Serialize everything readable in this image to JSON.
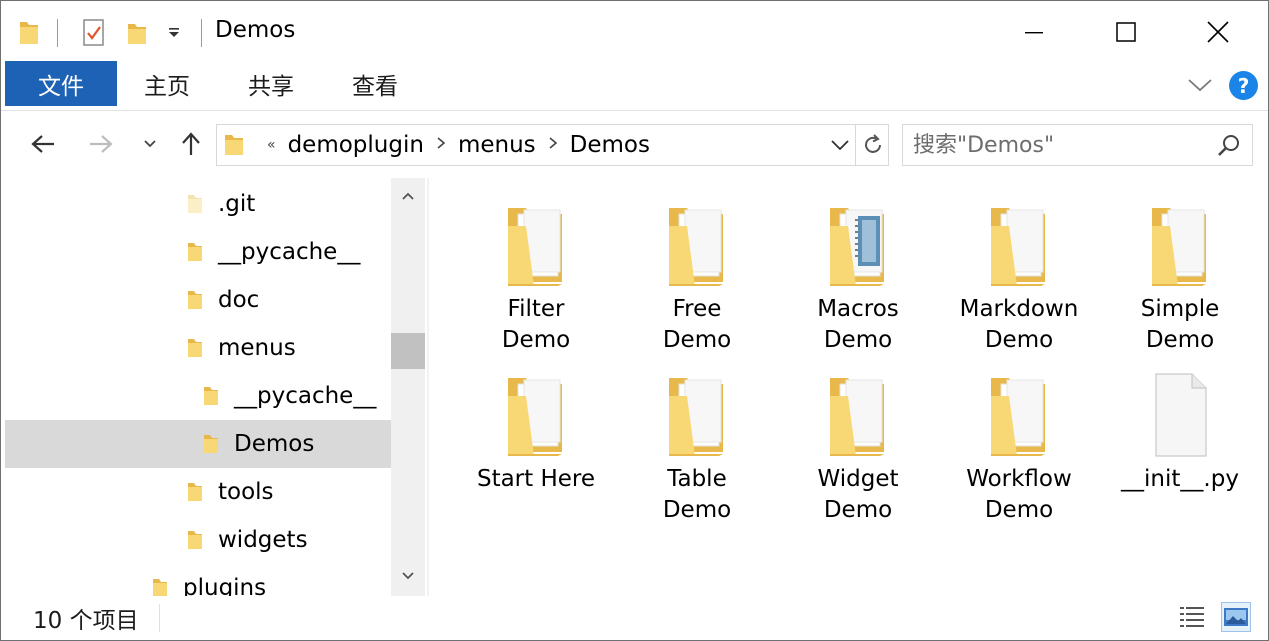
{
  "window": {
    "title": "Demos"
  },
  "ribbon": {
    "tabs": [
      {
        "label": "文件"
      },
      {
        "label": "主页"
      },
      {
        "label": "共享"
      },
      {
        "label": "查看"
      }
    ],
    "help_label": "?"
  },
  "address": {
    "overflow_glyph": "«",
    "segments": [
      "demoplugin",
      "menus",
      "Demos"
    ]
  },
  "search": {
    "placeholder": "搜索\"Demos\""
  },
  "tree": {
    "items": [
      {
        "label": ".git",
        "level": 1
      },
      {
        "label": "__pycache__",
        "level": 1
      },
      {
        "label": "doc",
        "level": 1
      },
      {
        "label": "menus",
        "level": 1
      },
      {
        "label": "__pycache__",
        "level": 2
      },
      {
        "label": "Demos",
        "level": 2,
        "selected": true
      },
      {
        "label": "tools",
        "level": 1
      },
      {
        "label": "widgets",
        "level": 1
      },
      {
        "label": "plugins",
        "level": 0
      }
    ]
  },
  "content": {
    "items": [
      {
        "name_line1": "Filter",
        "name_line2": "Demo",
        "kind": "folder"
      },
      {
        "name_line1": "Free",
        "name_line2": "Demo",
        "kind": "folder"
      },
      {
        "name_line1": "Macros",
        "name_line2": "Demo",
        "kind": "folder-notebook"
      },
      {
        "name_line1": "Markdown",
        "name_line2": "Demo",
        "kind": "folder"
      },
      {
        "name_line1": "Simple",
        "name_line2": "Demo",
        "kind": "folder"
      },
      {
        "name_line1": "Start Here",
        "name_line2": "",
        "kind": "folder"
      },
      {
        "name_line1": "Table",
        "name_line2": "Demo",
        "kind": "folder"
      },
      {
        "name_line1": "Widget",
        "name_line2": "Demo",
        "kind": "folder"
      },
      {
        "name_line1": "Workflow",
        "name_line2": "Demo",
        "kind": "folder"
      },
      {
        "name_line1": "__init__.py",
        "name_line2": "",
        "kind": "file"
      }
    ]
  },
  "status": {
    "text": "10 个项目"
  },
  "colors": {
    "accent": "#1e62b5",
    "folder_yellow": "#f8d775",
    "folder_dark": "#e8b84a",
    "selection": "#d9d9d9",
    "help_blue": "#1b84e8"
  }
}
